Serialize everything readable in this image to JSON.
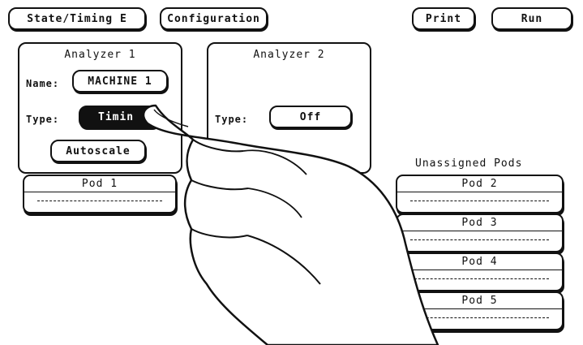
{
  "top_bar": {
    "state_timing_label": "State/Timing E",
    "configuration_label": "Configuration",
    "print_label": "Print",
    "run_label": "Run"
  },
  "analyzer1": {
    "title": "Analyzer 1",
    "name_label": "Name:",
    "name_value": "MACHINE 1",
    "type_label": "Type:",
    "type_value": "Timin",
    "autoscale_label": "Autoscale",
    "pods": [
      {
        "label": "Pod 1"
      }
    ]
  },
  "analyzer2": {
    "title": "Analyzer 2",
    "type_label": "Type:",
    "type_value": "Off"
  },
  "unassigned": {
    "title": "Unassigned Pods",
    "pods": [
      {
        "label": "Pod 2"
      },
      {
        "label": "Pod 3"
      },
      {
        "label": "Pod 4"
      },
      {
        "label": "Pod 5"
      }
    ]
  }
}
